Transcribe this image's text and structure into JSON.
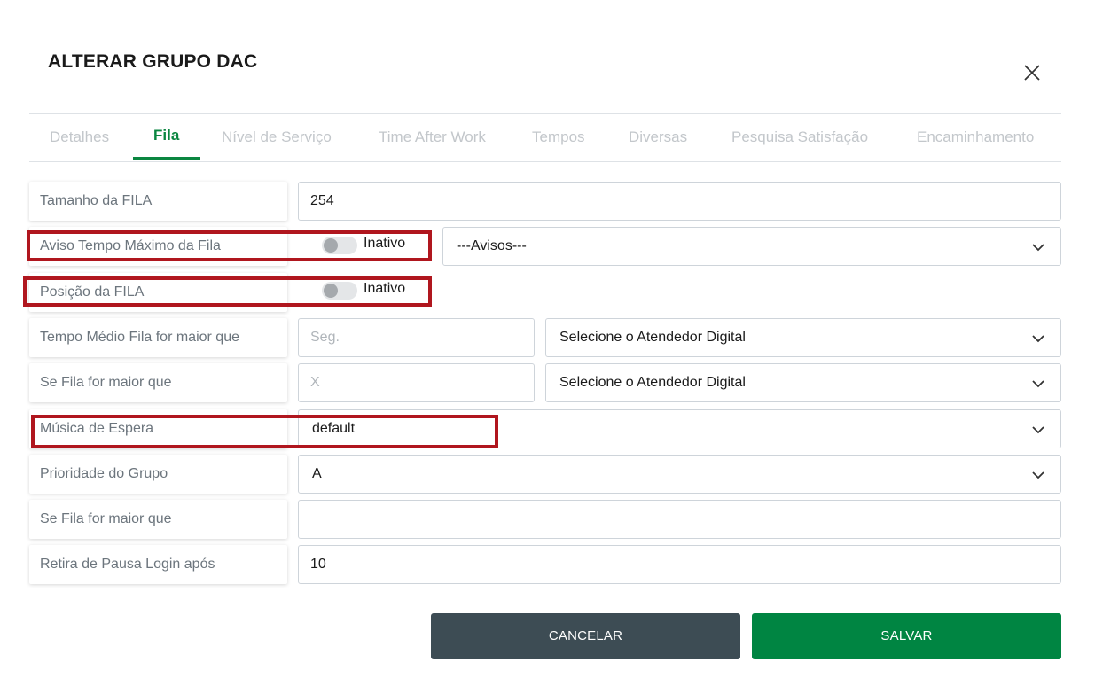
{
  "dialog": {
    "title": "ALTERAR GRUPO DAC"
  },
  "tabs": [
    {
      "label": "Detalhes"
    },
    {
      "label": "Fila",
      "active": true
    },
    {
      "label": "Nível de Serviço"
    },
    {
      "label": "Time After Work"
    },
    {
      "label": "Tempos"
    },
    {
      "label": "Diversas"
    },
    {
      "label": "Pesquisa Satisfação"
    },
    {
      "label": "Encaminhamento"
    }
  ],
  "form": {
    "tamanho_fila": {
      "label": "Tamanho da FILA",
      "value": "254"
    },
    "aviso_tempo": {
      "label": "Aviso Tempo Máximo da Fila",
      "toggle_state": "Inativo",
      "select_value": "---Avisos---"
    },
    "posicao_fila": {
      "label": "Posição da FILA",
      "toggle_state": "Inativo"
    },
    "tempo_medio": {
      "label": "Tempo Médio Fila for maior que",
      "placeholder": "Seg.",
      "select_value": "Selecione o Atendedor Digital"
    },
    "se_fila_maior_1": {
      "label": "Se Fila for maior que",
      "placeholder": "X",
      "select_value": "Selecione o Atendedor Digital"
    },
    "musica_espera": {
      "label": "Música de Espera",
      "select_value": "default"
    },
    "prioridade": {
      "label": "Prioridade do Grupo",
      "select_value": "A"
    },
    "se_fila_maior_2": {
      "label": "Se Fila for maior que",
      "value": ""
    },
    "retira_pausa": {
      "label": "Retira de Pausa Login após",
      "value": "10"
    }
  },
  "buttons": {
    "cancel": "CANCELAR",
    "save": "SALVAR"
  },
  "colors": {
    "accent": "#008542",
    "highlight": "#b0161e",
    "cancel": "#3d4c54"
  },
  "icons": {
    "close": "close-icon",
    "dropdown": "chevron-down-icon"
  }
}
